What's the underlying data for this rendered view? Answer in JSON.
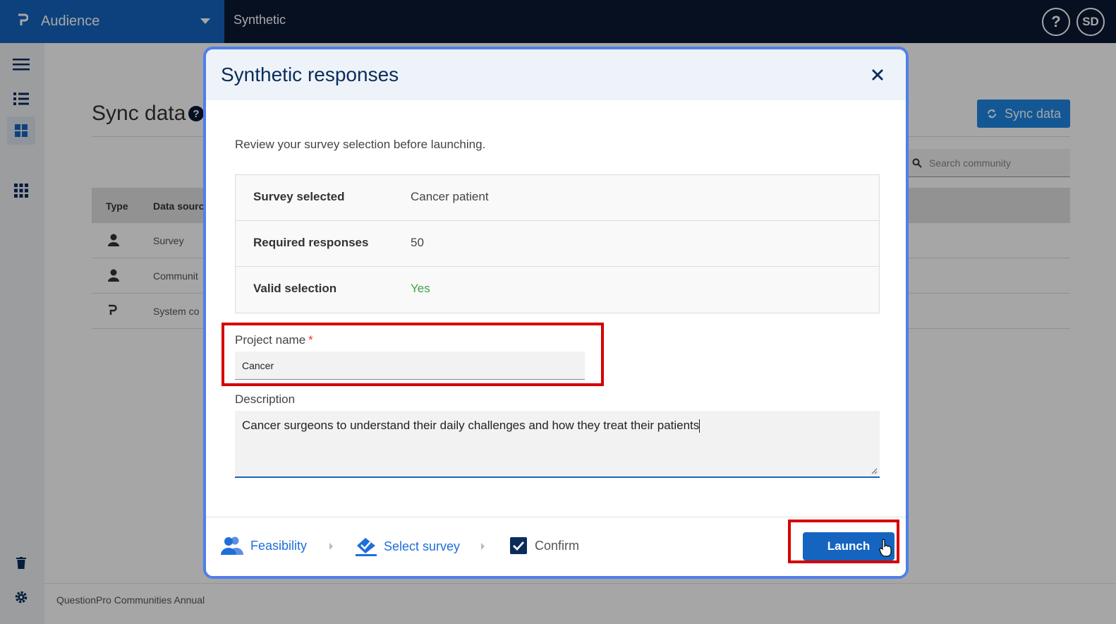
{
  "app": {
    "brand_name": "Audience",
    "section_title": "Synthetic",
    "help_label": "?",
    "avatar_initials": "SD"
  },
  "page": {
    "title": "Sync data",
    "title_help": "?",
    "sync_button": "Sync data",
    "search_placeholder": "Search community",
    "table_headers": [
      "Type",
      "Data sourc"
    ],
    "rows": [
      {
        "type_icon": "person-icon",
        "source": "Survey"
      },
      {
        "type_icon": "person-icon",
        "source": "Communit"
      },
      {
        "type_icon": "logo-icon",
        "source": "System co"
      }
    ],
    "footer": "QuestionPro Communities Annual"
  },
  "modal": {
    "title": "Synthetic responses",
    "intro": "Review your survey selection before launching.",
    "summary": [
      {
        "label": "Survey selected",
        "value": "Cancer patient"
      },
      {
        "label": "Required responses",
        "value": "50"
      },
      {
        "label": "Valid selection",
        "value": "Yes"
      }
    ],
    "project_name_label": "Project name",
    "required_mark": "*",
    "project_name_value": "Cancer",
    "description_label": "Description",
    "description_value": "Cancer surgeons to understand their daily challenges and how they treat their patients",
    "steps": [
      {
        "label": "Feasibility"
      },
      {
        "label": "Select survey"
      },
      {
        "label": "Confirm"
      }
    ],
    "launch_label": "Launch"
  },
  "colors": {
    "brand_blue": "#1565c0",
    "topbar": "#0b1a33",
    "valid_green": "#43a047",
    "highlight_red": "#d50000",
    "modal_border": "#4f7fea"
  }
}
